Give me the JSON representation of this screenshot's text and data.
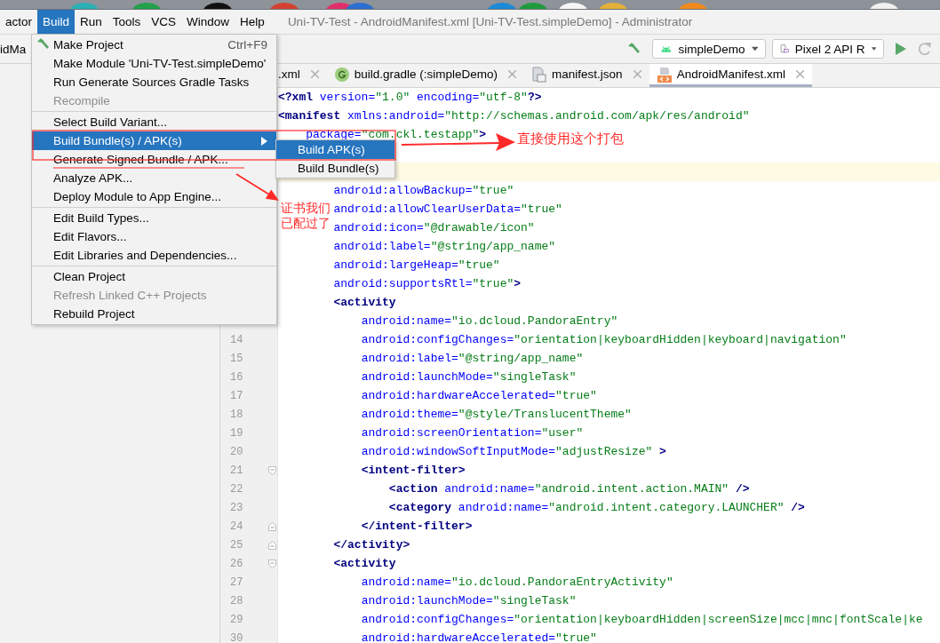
{
  "menu_bar": {
    "items": [
      {
        "label": "actor",
        "selected": false
      },
      {
        "label": "Build",
        "selected": true
      },
      {
        "label": "Run",
        "selected": false
      },
      {
        "label": "Tools",
        "selected": false
      },
      {
        "label": "VCS",
        "selected": false
      },
      {
        "label": "Window",
        "selected": false
      },
      {
        "label": "Help",
        "selected": false
      }
    ],
    "title": "Uni-TV-Test - AndroidManifest.xml [Uni-TV-Test.simpleDemo] - Administrator"
  },
  "toolbar": {
    "breadcrumb": "idMa",
    "configuration": "simpleDemo",
    "device": "Pixel 2 API R"
  },
  "tabs": [
    {
      "kind": "plain",
      "label": ".xml",
      "selected": false
    },
    {
      "kind": "gradle",
      "label": "build.gradle (:simpleDemo)",
      "selected": false
    },
    {
      "kind": "json",
      "label": "manifest.json",
      "selected": false
    },
    {
      "kind": "xml",
      "label": "AndroidManifest.xml",
      "selected": true
    }
  ],
  "editor": {
    "lines": [
      {
        "current": false,
        "segments": [
          {
            "kind": "tag",
            "text": "<?xml"
          },
          {
            "kind": "attr",
            "text": " version="
          },
          {
            "kind": "value",
            "text": "\"1.0\""
          },
          {
            "kind": "attr",
            "text": " encoding="
          },
          {
            "kind": "value",
            "text": "\"utf-8\""
          },
          {
            "kind": "tag",
            "text": "?>"
          }
        ]
      },
      {
        "current": false,
        "segments": [
          {
            "kind": "tag",
            "text": "<manifest"
          },
          {
            "kind": "attr",
            "text": " xmlns:android="
          },
          {
            "kind": "value",
            "text": "\"http://schemas.android.com/apk/res/android\""
          }
        ]
      },
      {
        "current": false,
        "segments": [
          {
            "kind": "attr",
            "text": "    package="
          },
          {
            "kind": "value",
            "text": "\"com.ckl.testapp\""
          },
          {
            "kind": "tag",
            "text": ">"
          }
        ]
      },
      {
        "current": false
      },
      {
        "current": true
      },
      {
        "current": false,
        "segments": [
          {
            "kind": "attr",
            "text": "        android:allowBackup="
          },
          {
            "kind": "value",
            "text": "\"true\""
          }
        ]
      },
      {
        "current": false,
        "segments": [
          {
            "kind": "attr",
            "text": "        android:allowClearUserData="
          },
          {
            "kind": "value",
            "text": "\"true\""
          }
        ]
      },
      {
        "current": false,
        "segments": [
          {
            "kind": "attr",
            "text": "        android:icon="
          },
          {
            "kind": "value",
            "text": "\"@drawable/icon\""
          }
        ]
      },
      {
        "current": false,
        "segments": [
          {
            "kind": "attr",
            "text": "        android:label="
          },
          {
            "kind": "value",
            "text": "\"@string/app_name\""
          }
        ]
      },
      {
        "current": false,
        "segments": [
          {
            "kind": "attr",
            "text": "        android:largeHeap="
          },
          {
            "kind": "value",
            "text": "\"true\""
          }
        ]
      },
      {
        "current": false,
        "segments": [
          {
            "kind": "attr",
            "text": "        android:supportsRtl="
          },
          {
            "kind": "value",
            "text": "\"true\""
          },
          {
            "kind": "tag",
            "text": ">"
          }
        ]
      },
      {
        "current": false,
        "segments": [
          {
            "kind": "tag",
            "text": "        <activity"
          }
        ]
      },
      {
        "current": false,
        "segments": [
          {
            "kind": "attr",
            "text": "            android:name="
          },
          {
            "kind": "value",
            "text": "\"io.dcloud.PandoraEntry\""
          }
        ]
      },
      {
        "number": "14",
        "current": false,
        "segments": [
          {
            "kind": "attr",
            "text": "            android:configChanges="
          },
          {
            "kind": "value",
            "text": "\"orientation|keyboardHidden|keyboard|navigation\""
          }
        ]
      },
      {
        "number": "15",
        "current": false,
        "segments": [
          {
            "kind": "attr",
            "text": "            android:label="
          },
          {
            "kind": "value",
            "text": "\"@string/app_name\""
          }
        ]
      },
      {
        "number": "16",
        "current": false,
        "segments": [
          {
            "kind": "attr",
            "text": "            android:launchMode="
          },
          {
            "kind": "value",
            "text": "\"singleTask\""
          }
        ]
      },
      {
        "number": "17",
        "current": false,
        "segments": [
          {
            "kind": "attr",
            "text": "            android:hardwareAccelerated="
          },
          {
            "kind": "value",
            "text": "\"true\""
          }
        ]
      },
      {
        "number": "18",
        "current": false,
        "segments": [
          {
            "kind": "attr",
            "text": "            android:theme="
          },
          {
            "kind": "value",
            "text": "\"@style/TranslucentTheme\""
          }
        ]
      },
      {
        "number": "19",
        "current": false,
        "segments": [
          {
            "kind": "attr",
            "text": "            android:screenOrientation="
          },
          {
            "kind": "value",
            "text": "\"user\""
          }
        ]
      },
      {
        "number": "20",
        "current": false,
        "segments": [
          {
            "kind": "attr",
            "text": "            android:windowSoftInputMode="
          },
          {
            "kind": "value",
            "text": "\"adjustResize\""
          },
          {
            "kind": "tag",
            "text": " >"
          }
        ]
      },
      {
        "number": "21",
        "kind": "fold_start",
        "current": false,
        "segments": [
          {
            "kind": "tag",
            "text": "            <intent-filter>"
          }
        ]
      },
      {
        "number": "22",
        "current": false,
        "segments": [
          {
            "kind": "tag",
            "text": "                <action"
          },
          {
            "kind": "attr",
            "text": " android:name="
          },
          {
            "kind": "value",
            "text": "\"android.intent.action.MAIN\""
          },
          {
            "kind": "tag",
            "text": " />"
          }
        ]
      },
      {
        "number": "23",
        "current": false,
        "segments": [
          {
            "kind": "tag",
            "text": "                <category"
          },
          {
            "kind": "attr",
            "text": " android:name="
          },
          {
            "kind": "value",
            "text": "\"android.intent.category.LAUNCHER\""
          },
          {
            "kind": "tag",
            "text": " />"
          }
        ]
      },
      {
        "number": "24",
        "kind": "fold_end",
        "current": false,
        "segments": [
          {
            "kind": "tag",
            "text": "            </intent-filter>"
          }
        ]
      },
      {
        "number": "25",
        "kind": "fold_end",
        "current": false,
        "segments": [
          {
            "kind": "tag",
            "text": "        </activity>"
          }
        ]
      },
      {
        "number": "26",
        "kind": "fold_start",
        "current": false,
        "segments": [
          {
            "kind": "tag",
            "text": "        <activity"
          }
        ]
      },
      {
        "number": "27",
        "current": false,
        "segments": [
          {
            "kind": "attr",
            "text": "            android:name="
          },
          {
            "kind": "value",
            "text": "\"io.dcloud.PandoraEntryActivity\""
          }
        ]
      },
      {
        "number": "28",
        "current": false,
        "segments": [
          {
            "kind": "attr",
            "text": "            android:launchMode="
          },
          {
            "kind": "value",
            "text": "\"singleTask\""
          }
        ]
      },
      {
        "number": "29",
        "current": false,
        "segments": [
          {
            "kind": "attr",
            "text": "            android:configChanges="
          },
          {
            "kind": "value",
            "text": "\"orientation|keyboardHidden|screenSize|mcc|mnc|fontScale|ke"
          }
        ]
      },
      {
        "number": "30",
        "current": false,
        "segments": [
          {
            "kind": "attr",
            "text": "            android:hardwareAccelerated="
          },
          {
            "kind": "value",
            "text": "\"true\""
          }
        ]
      }
    ]
  },
  "build_menu": {
    "items": [
      {
        "kind": "icon_item",
        "label": "Make Project",
        "shortcut": "Ctrl+F9",
        "disabled": false,
        "selected": false
      },
      {
        "kind": "item",
        "label": "Make Module 'Uni-TV-Test.simpleDemo'",
        "disabled": false,
        "selected": false
      },
      {
        "kind": "item",
        "label": "Run Generate Sources Gradle Tasks",
        "disabled": false,
        "selected": false
      },
      {
        "kind": "item",
        "label": "Recompile",
        "disabled": true,
        "selected": false
      },
      {
        "kind": "separator"
      },
      {
        "kind": "item",
        "label": "Select Build Variant...",
        "disabled": false,
        "selected": false
      },
      {
        "kind": "submenu_item",
        "label": "Build Bundle(s) / APK(s)",
        "disabled": false,
        "selected": true
      },
      {
        "kind": "item",
        "label": "Generate Signed Bundle / APK...",
        "disabled": false,
        "selected": false
      },
      {
        "kind": "item",
        "label": "Analyze APK...",
        "disabled": false,
        "selected": false
      },
      {
        "kind": "item",
        "label": "Deploy Module to App Engine...",
        "disabled": false,
        "selected": false
      },
      {
        "kind": "separator"
      },
      {
        "kind": "item",
        "label": "Edit Build Types...",
        "disabled": false,
        "selected": false
      },
      {
        "kind": "item",
        "label": "Edit Flavors...",
        "disabled": false,
        "selected": false
      },
      {
        "kind": "item",
        "label": "Edit Libraries and Dependencies...",
        "disabled": false,
        "selected": false
      },
      {
        "kind": "separator"
      },
      {
        "kind": "item",
        "label": "Clean Project",
        "disabled": false,
        "selected": false
      },
      {
        "kind": "item",
        "label": "Refresh Linked C++ Projects",
        "disabled": true,
        "selected": false
      },
      {
        "kind": "item",
        "label": "Rebuild Project",
        "disabled": false,
        "selected": false
      }
    ],
    "submenu": [
      {
        "label": "Build APK(s)",
        "selected": true
      },
      {
        "label": "Build Bundle(s)",
        "selected": false
      }
    ]
  },
  "annotations": [
    {
      "text": "直接使用这个打包"
    },
    {
      "text": "证书我们已配过了"
    }
  ]
}
